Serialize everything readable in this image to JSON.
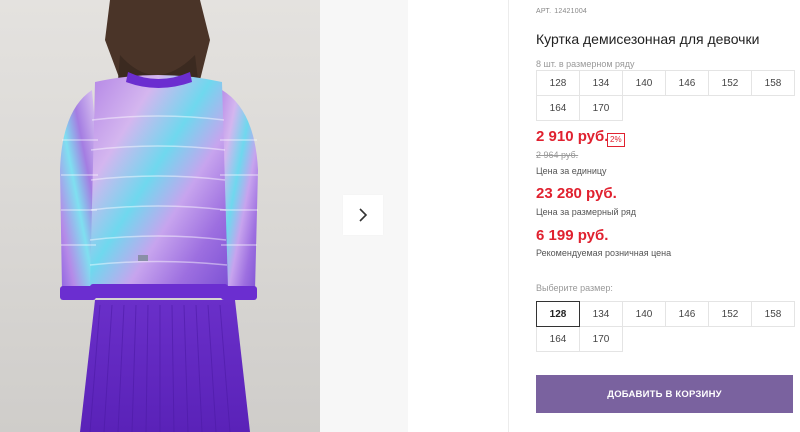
{
  "product": {
    "article_label": "АРТ.",
    "article": "12421004",
    "title": "Куртка демисезонная для девочки",
    "pack_note": "8 шт. в размерном ряду",
    "pack_sizes": [
      "128",
      "134",
      "140",
      "146",
      "152",
      "158",
      "164",
      "170"
    ]
  },
  "pricing": {
    "unit_price": "2 910 руб.",
    "discount": "2%",
    "old_price": "2 964 руб.",
    "unit_label": "Цена за единицу",
    "row_price": "23 280 руб.",
    "row_label": "Цена за размерный ряд",
    "retail_price": "6 199 руб.",
    "retail_label": "Рекомендуемая розничная цена"
  },
  "size_select": {
    "label": "Выберите размер:",
    "sizes": [
      "128",
      "134",
      "140",
      "146",
      "152",
      "158",
      "164",
      "170"
    ],
    "selected": "128"
  },
  "cart": {
    "label": "ДОБАВИТЬ В КОРЗИНУ"
  },
  "gallery": {
    "next_icon": "chevron-right-icon"
  },
  "colors": {
    "accent_red": "#e0212f",
    "button": "#7a629f"
  }
}
